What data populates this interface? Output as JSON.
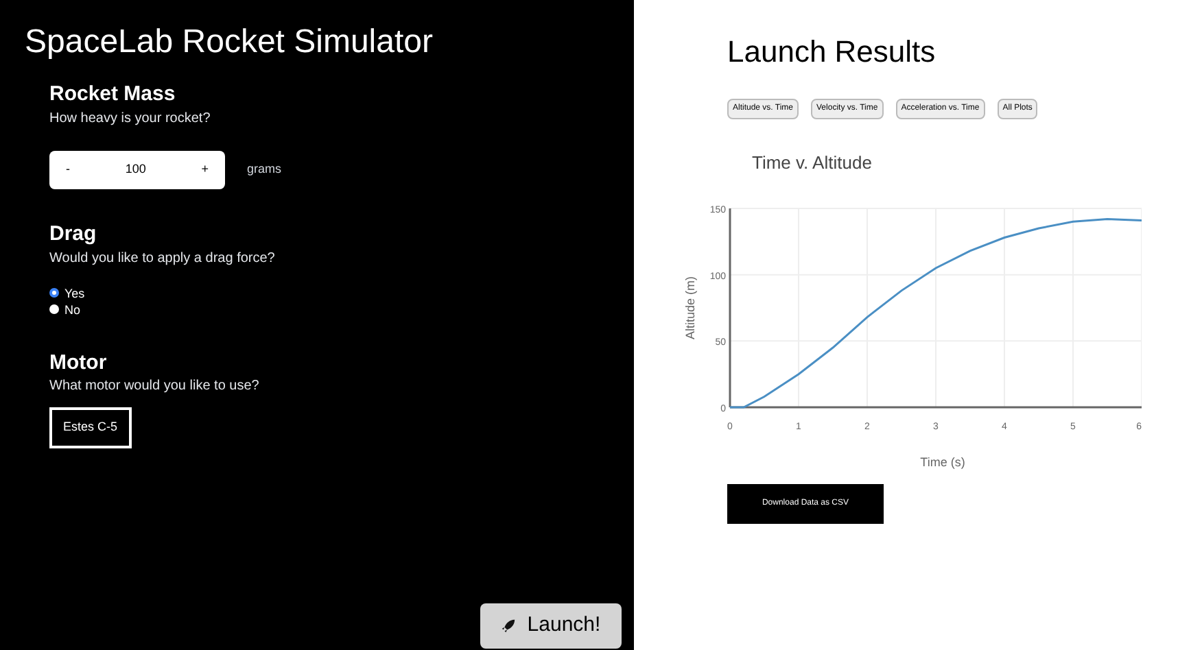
{
  "app_title": "SpaceLab Rocket Simulator",
  "sections": [
    {
      "kind": "stepper",
      "title": "Rocket Mass",
      "question": "How heavy is your rocket?",
      "minus": "-",
      "value": "100",
      "plus": "+",
      "unit": "grams"
    },
    {
      "kind": "radio",
      "title": "Drag",
      "question": "Would you like to apply a drag force?",
      "options": [
        {
          "label": "Yes",
          "selected": true
        },
        {
          "label": "No",
          "selected": false
        }
      ]
    },
    {
      "kind": "choice",
      "title": "Motor",
      "question": "What motor would you like to use?",
      "button": "Estes C-5"
    }
  ],
  "launch_button": "Launch!",
  "results": {
    "title": "Launch Results",
    "plot_tabs": [
      "Altitude vs. Time",
      "Velocity vs. Time",
      "Acceleration vs. Time",
      "All Plots"
    ],
    "chart_data": {
      "type": "line",
      "title": "Time v. Altitude",
      "xlabel": "Time (s)",
      "ylabel": "Altitude (m)",
      "xlim": [
        0,
        6
      ],
      "ylim": [
        0,
        150
      ],
      "xticks": [
        0,
        1,
        2,
        3,
        4,
        5,
        6
      ],
      "yticks": [
        0,
        50,
        100,
        150
      ],
      "x": [
        0,
        0.2,
        0.5,
        1,
        1.5,
        2,
        2.5,
        3,
        3.5,
        4,
        4.5,
        5,
        5.5,
        6
      ],
      "grid": true,
      "series": [
        {
          "color": "#4a8fc4",
          "values": [
            0,
            0,
            8,
            25,
            45,
            68,
            88,
            105,
            118,
            128,
            135,
            140,
            142,
            141
          ]
        }
      ]
    },
    "download_button": "Download Data as CSV"
  }
}
